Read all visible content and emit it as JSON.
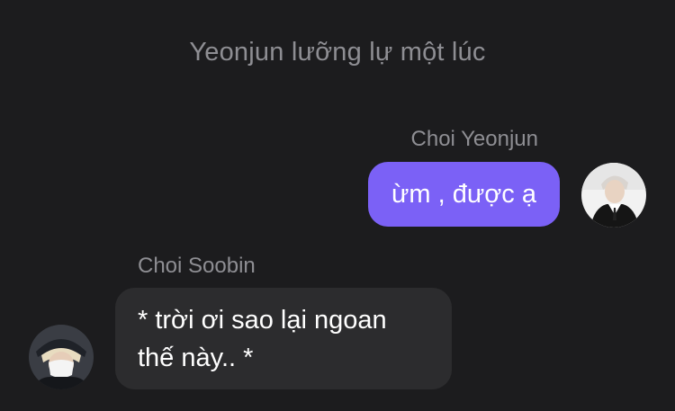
{
  "chat": {
    "system_message": "Yeonjun lưỡng lự một lúc",
    "messages": [
      {
        "sender": "Choi Yeonjun",
        "text": "ừm , được ạ",
        "avatar_icon": "person-avatar-icon",
        "bubble_color": "#7b61f6"
      },
      {
        "sender": "Choi Soobin",
        "text": "* trời ơi sao lại ngoan thế này.. *",
        "avatar_icon": "person-avatar-icon",
        "bubble_color": "#2c2c2e"
      }
    ]
  },
  "colors": {
    "background": "#1c1c1e",
    "secondary_text": "#8e8e93",
    "accent": "#7b61f6"
  }
}
